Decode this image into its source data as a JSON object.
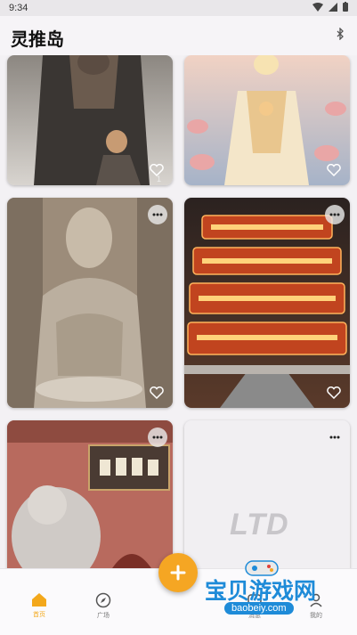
{
  "status": {
    "time": "9:34"
  },
  "app": {
    "title": "灵推岛"
  },
  "cards": [
    {
      "like_count": "1"
    },
    {
      "like_count": ""
    },
    {
      "like_count": ""
    },
    {
      "like_count": ""
    },
    {
      "like_count": ""
    },
    {
      "watermark": "LTD"
    }
  ],
  "nav": {
    "items": [
      {
        "label": "首页",
        "icon": "home-icon",
        "active": true
      },
      {
        "label": "广场",
        "icon": "compass-icon",
        "active": false
      },
      {
        "label": "消息",
        "icon": "message-icon",
        "active": false
      },
      {
        "label": "我的",
        "icon": "profile-icon",
        "active": false
      }
    ]
  },
  "promo": {
    "site_name": "宝贝游戏网",
    "url": "baobeiy.com"
  },
  "colors": {
    "accent": "#f5a623",
    "promo_blue": "#1e8bd8"
  }
}
